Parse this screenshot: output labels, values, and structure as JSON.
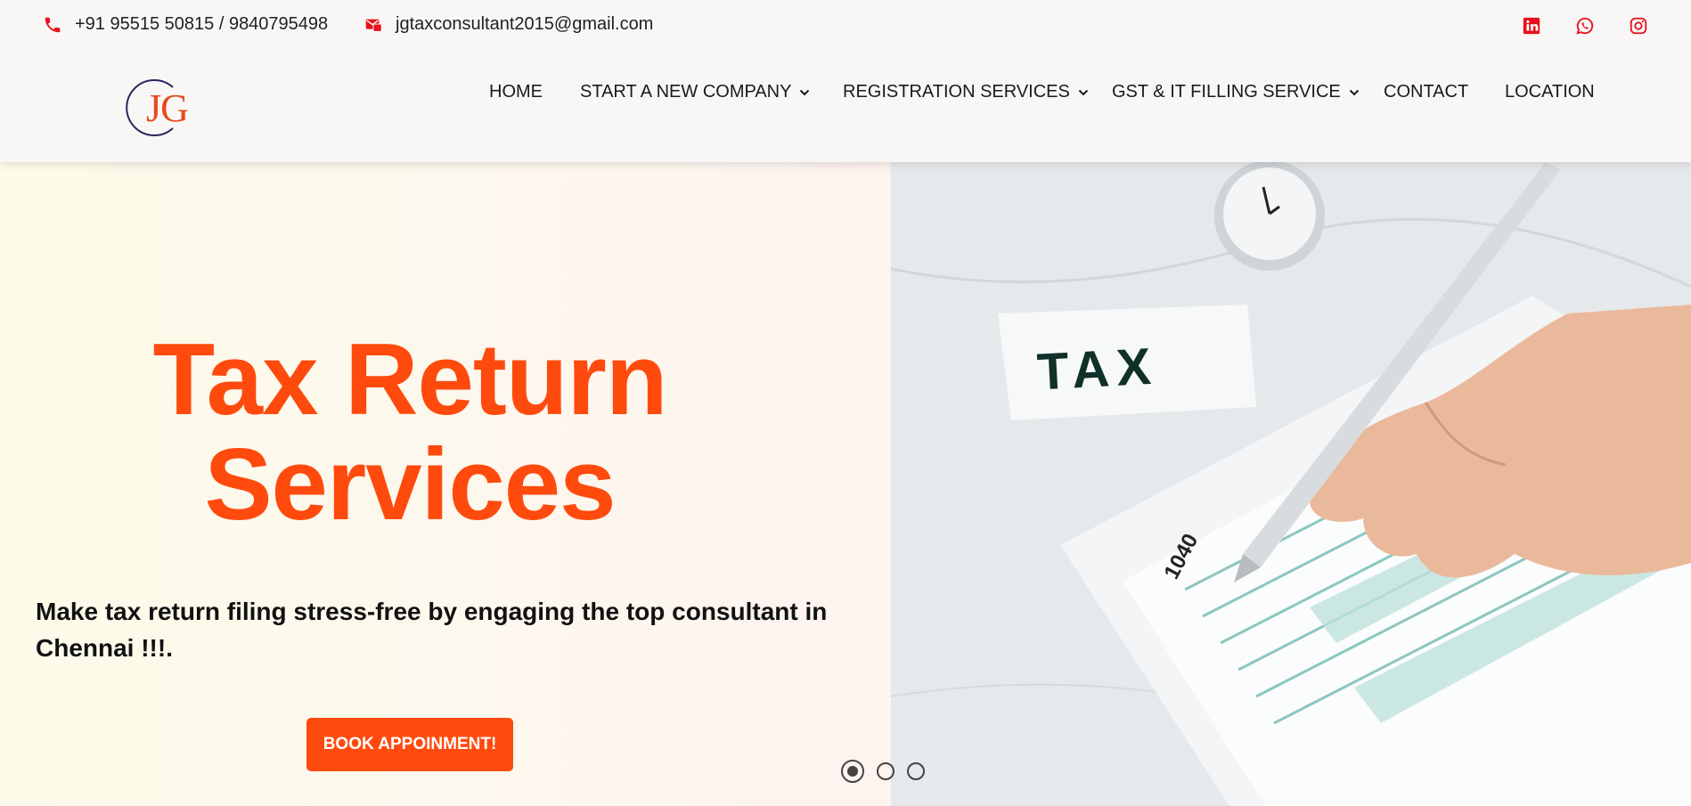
{
  "topbar": {
    "phone": "+91 95515 50815 / 9840795498",
    "email": "jgtaxconsultant2015@gmail.com",
    "social": [
      "linkedin-icon",
      "whatsapp-icon",
      "instagram-icon"
    ]
  },
  "header": {
    "logo_text": "JG",
    "nav": [
      {
        "label": "HOME",
        "dropdown": false
      },
      {
        "label": "START A NEW COMPANY",
        "dropdown": true
      },
      {
        "label": "REGISTRATION SERVICES",
        "dropdown": true
      },
      {
        "label": "GST & IT FILLING SERVICE",
        "dropdown": true
      },
      {
        "label": "CONTACT",
        "dropdown": false
      },
      {
        "label": "LOCATION",
        "dropdown": false
      }
    ]
  },
  "hero": {
    "title_line1": "Tax Return",
    "title_line2": "Services",
    "subtitle": "Make tax return filing stress-free by engaging the top consultant in Chennai !!!.",
    "cta": "BOOK APPOINMENT!",
    "image_word": "TAX",
    "image_form_number": "1040",
    "slides": 3,
    "active_slide": 1
  },
  "colors": {
    "accent": "#ff4a0e",
    "icon_red": "#e8101c",
    "background": "#f8f7f5"
  }
}
